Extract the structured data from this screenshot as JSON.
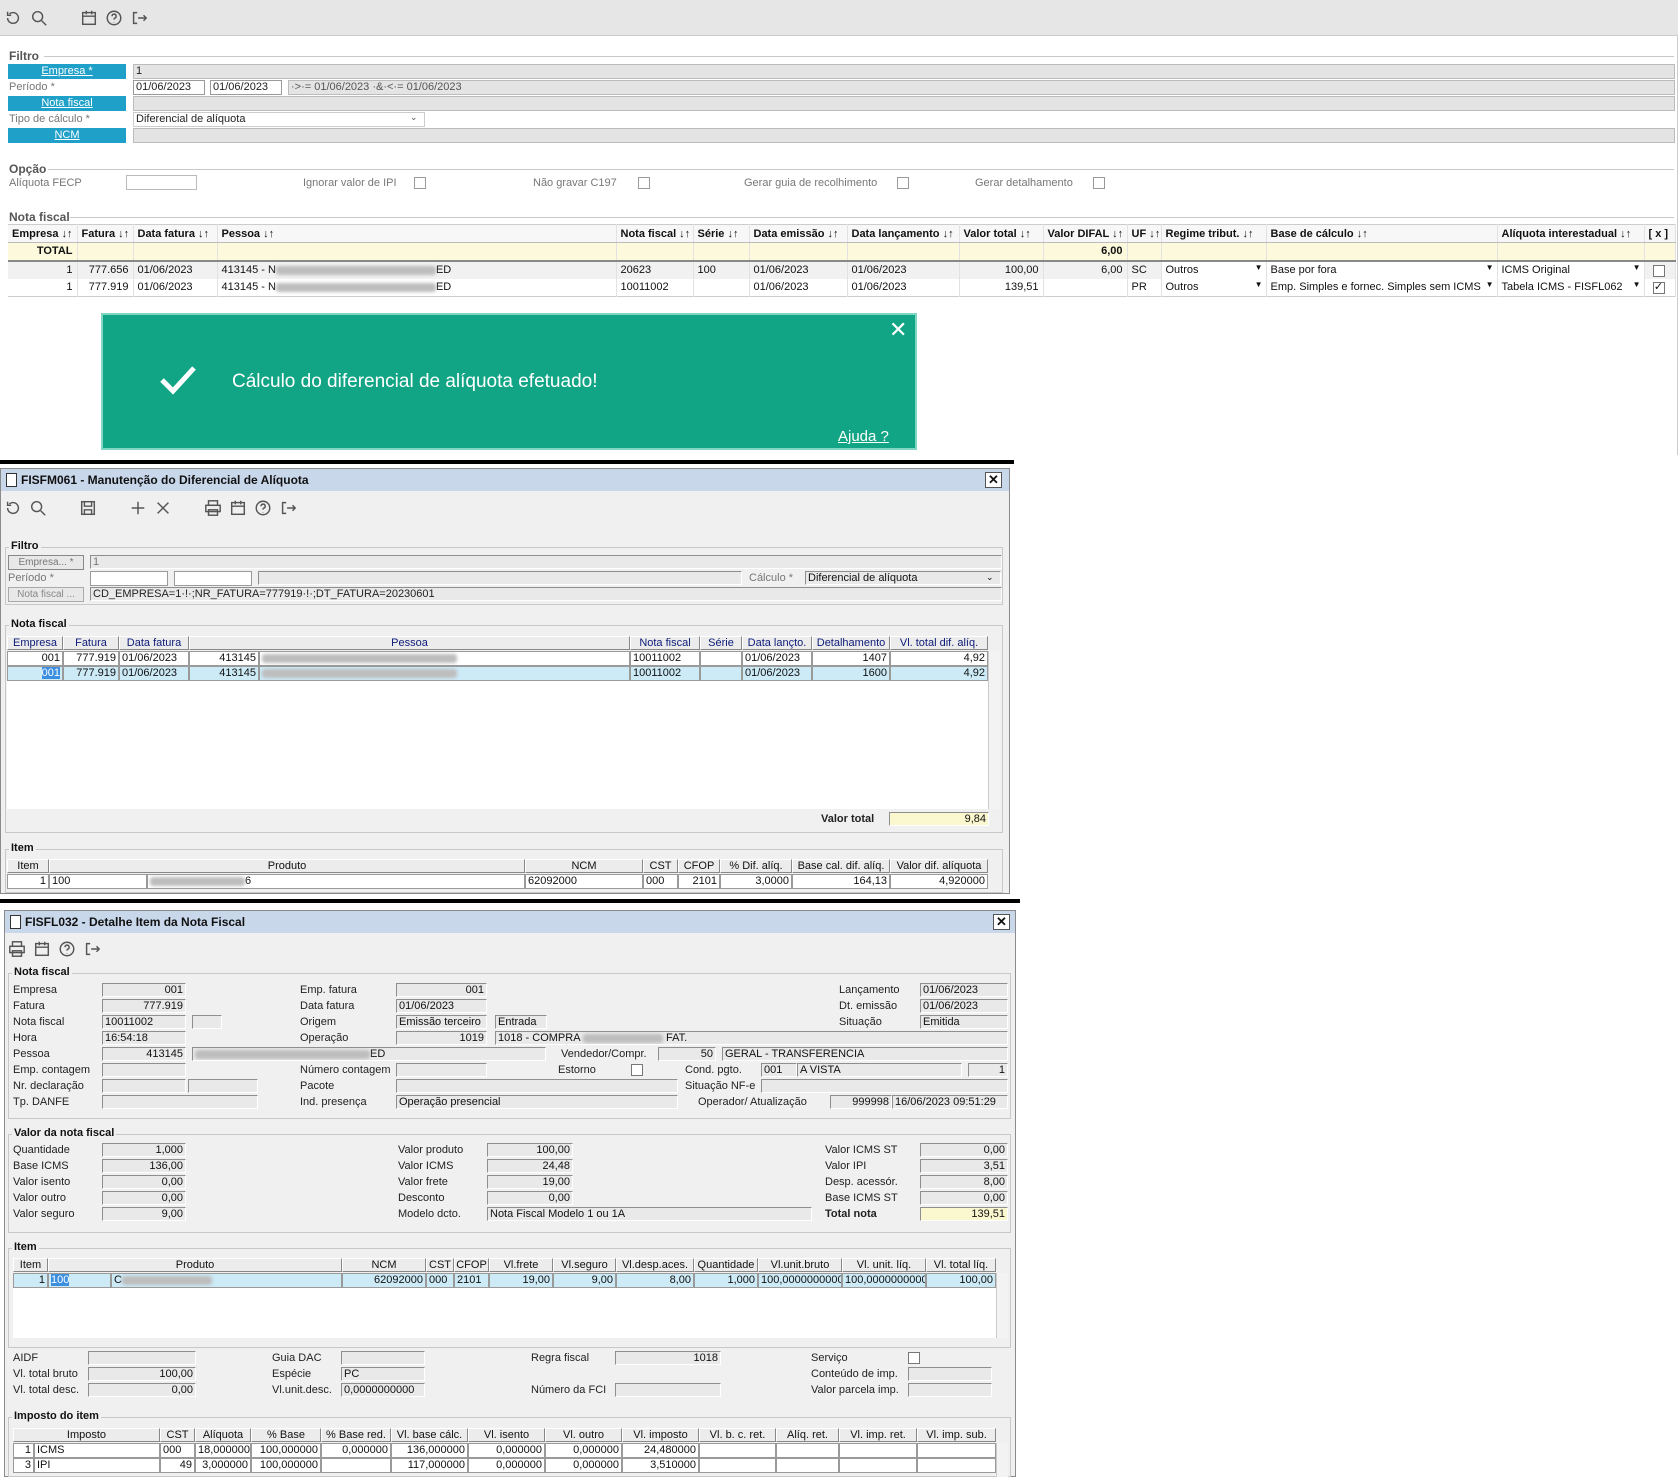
{
  "top": {
    "filtro": "Filtro",
    "empresa_label": "Empresa *",
    "empresa_value": "1",
    "periodo_label": "Período *",
    "periodo_from": "01/06/2023",
    "periodo_to": "01/06/2023",
    "periodo_expr": "·>·= 01/06/2023 ·&·<·= 01/06/2023",
    "nota_label": "Nota fiscal",
    "tipo_label": "Tipo de cálculo *",
    "tipo_value": "Diferencial de alíquota",
    "ncm_label": "NCM",
    "opcao": "Opção",
    "aliq_fecp": "Alíquota FECP",
    "ign_ipi": "Ignorar valor de IPI",
    "nao_gravar": "Não gravar C197",
    "gerar_guia": "Gerar guia de recolhimento",
    "gerar_det": "Gerar detalhamento",
    "nota_sect": "Nota fiscal",
    "cols": [
      "Empresa ↓↑",
      "Fatura ↓↑",
      "Data fatura ↓↑",
      "Pessoa ↓↑",
      "Nota fiscal ↓↑",
      "Série ↓↑",
      "Data emissão ↓↑",
      "Data lançamento ↓↑",
      "Valor total ↓↑",
      "Valor DIFAL ↓↑",
      "UF ↓↑",
      "Regime tribut. ↓↑",
      "Base de cálculo ↓↑",
      "Alíquota interestadual ↓↑",
      "[ x ]"
    ],
    "total_label": "TOTAL",
    "total_difal": "6,00",
    "rows": [
      {
        "empresa": "1",
        "fatura": "777.656",
        "data": "01/06/2023",
        "pessoa": "413145 - N",
        "pessoa_end": "ED",
        "nota": "20623",
        "serie": "100",
        "emissao": "01/06/2023",
        "lanc": "01/06/2023",
        "valor": "100,00",
        "difal": "6,00",
        "uf": "SC",
        "regime": "Outros",
        "base": "Base por fora",
        "aliq": "ICMS Original"
      },
      {
        "empresa": "1",
        "fatura": "777.919",
        "data": "01/06/2023",
        "pessoa": "413145 - N",
        "pessoa_end": "ED",
        "nota": "10011002",
        "serie": "",
        "emissao": "01/06/2023",
        "lanc": "01/06/2023",
        "valor": "139,51",
        "difal": "",
        "uf": "PR",
        "regime": "Outros",
        "base": "Emp. Simples e fornec. Simples sem ICMS",
        "aliq": "Tabela ICMS - FISFL062"
      }
    ],
    "toast": "Cálculo do diferencial de alíquota efetuado!",
    "ajuda": "Ajuda ?"
  },
  "win1": {
    "title": "FISFM061 - Manutenção do Diferencial de Alíquota",
    "filtro": "Filtro",
    "empresa": "Empresa... *",
    "empresa_value": "1",
    "periodo": "Período *",
    "calculo_label": "Cálculo *",
    "calculo_value": "Diferencial de alíquota",
    "nota_btn": "Nota fiscal ...",
    "nota_expr": "CD_EMPRESA=1·!·;NR_FATURA=777919·!·;DT_FATURA=20230601",
    "nota_sect": "Nota fiscal",
    "cols": [
      "Empresa",
      "Fatura",
      "Data fatura",
      "Pessoa",
      "Nota fiscal",
      "Série",
      "Data lançto.",
      "Detalhamento",
      "Vl. total dif. alíq."
    ],
    "rows": [
      {
        "empresa": "001",
        "fatura": "777.919",
        "data": "01/06/2023",
        "pessoa": "413145",
        "nota": "10011002",
        "serie": "",
        "lanc": "01/06/2023",
        "det": "1407",
        "vl": "4,92"
      },
      {
        "empresa": "001",
        "fatura": "777.919",
        "data": "01/06/2023",
        "pessoa": "413145",
        "nota": "10011002",
        "serie": "",
        "lanc": "01/06/2023",
        "det": "1600",
        "vl": "4,92"
      }
    ],
    "valor_total_label": "Valor total",
    "valor_total": "9,84",
    "item_sect": "Item",
    "icols": [
      "Item",
      "Produto",
      "NCM",
      "CST",
      "CFOP",
      "% Dif. alíq.",
      "Base cal. dif. alíq.",
      "Valor dif. alíquota"
    ],
    "irow": {
      "item": "1",
      "prod": "100",
      "prod_end": "6",
      "ncm": "62092000",
      "cst": "000",
      "cfop": "2101",
      "pct": "3,0000",
      "base": "164,13",
      "valor": "4,920000"
    }
  },
  "win2": {
    "title": "FISFL032 - Detalhe Item da Nota Fiscal",
    "nf_sect": "Nota fiscal",
    "empresa_l": "Empresa",
    "empresa": "001",
    "fatura_l": "Fatura",
    "fatura": "777.919",
    "nota_l": "Nota fiscal",
    "nota": "10011002",
    "hora_l": "Hora",
    "hora": "16:54:18",
    "pessoa_l": "Pessoa",
    "pessoa": "413145",
    "pessoa_end": "ED",
    "empc_l": "Emp. contagem",
    "nrdecl_l": "Nr. declaração",
    "tpdanfe_l": "Tp. DANFE",
    "empfat_l": "Emp. fatura",
    "empfat": "001",
    "datafat_l": "Data fatura",
    "datafat": "01/06/2023",
    "origem_l": "Origem",
    "origem": "Emissão terceiro",
    "origem2": "Entrada",
    "oper_l": "Operação",
    "oper": "1019",
    "oper_desc": "1018 - COMPRA",
    "oper_desc_end": "FAT.",
    "vend_l": "Vendedor/Compr.",
    "vend": "50",
    "vend_desc": "GERAL - TRANSFERENCIA",
    "numc_l": "Número contagem",
    "estorno_l": "Estorno",
    "cond_l": "Cond. pgto.",
    "cond": "001",
    "cond_desc": "A VISTA",
    "cond_n": "1",
    "pacote_l": "Pacote",
    "sit_nfe_l": "Situação NF-e",
    "indpres_l": "Ind. presença",
    "indpres": "Operação presencial",
    "operador_l": "Operador/ Atualização",
    "operador": "999998",
    "atual": "16/06/2023 09:51:29",
    "lanc_l": "Lançamento",
    "lanc": "01/06/2023",
    "dtem_l": "Dt. emissão",
    "dtem": "01/06/2023",
    "sit_l": "Situação",
    "sit": "Emitida",
    "valor_sect": "Valor da nota fiscal",
    "qtd_l": "Quantidade",
    "qtd": "1,000",
    "bicms_l": "Base ICMS",
    "bicms": "136,00",
    "visento_l": "Valor isento",
    "visento": "0,00",
    "voutro_l": "Valor outro",
    "voutro": "0,00",
    "vseg_l": "Valor seguro",
    "vseg": "9,00",
    "vprod_l": "Valor produto",
    "vprod": "100,00",
    "vicms_l": "Valor ICMS",
    "vicms": "24,48",
    "vfrete_l": "Valor frete",
    "vfrete": "19,00",
    "desc_l": "Desconto",
    "desc": "0,00",
    "modelo_l": "Modelo dcto.",
    "modelo": "Nota Fiscal Modelo 1 ou 1A",
    "vicmsst_l": "Valor ICMS ST",
    "vicmsst": "0,00",
    "vipi_l": "Valor IPI",
    "vipi": "3,51",
    "desp_l": "Desp. acessór.",
    "desp": "8,00",
    "bicmsst_l": "Base ICMS ST",
    "bicmsst": "0,00",
    "total_l": "Total nota",
    "total": "139,51",
    "item_sect": "Item",
    "icols": [
      "Item",
      "Produto",
      "NCM",
      "CST",
      "CFOP",
      "Vl.frete",
      "Vl.seguro",
      "Vl.desp.aces.",
      "Quantidade",
      "Vl.unit.bruto",
      "Vl. unit. líq.",
      "Vl. total líq."
    ],
    "irow": {
      "item": "1",
      "prod": "100",
      "prod2": "C",
      "ncm": "62092000",
      "cst": "000",
      "cfop": "2101",
      "frete": "19,00",
      "seguro": "9,00",
      "desp": "8,00",
      "qtd": "1,000",
      "ub": "100,0000000000",
      "ul": "100,0000000000",
      "tl": "100,00"
    },
    "aidf_l": "AIDF",
    "vtb_l": "Vl. total bruto",
    "vtb": "100,00",
    "vtd_l": "Vl. total desc.",
    "vtd": "0,00",
    "guia_l": "Guia DAC",
    "esp_l": "Espécie",
    "esp": "PC",
    "vud_l": "Vl.unit.desc.",
    "vud": "0,0000000000",
    "regra_l": "Regra fiscal",
    "regra": "1018",
    "fci_l": "Número da FCI",
    "serv_l": "Serviço",
    "cont_l": "Conteúdo de imp.",
    "vpi_l": "Valor parcela imp.",
    "imp_sect": "Imposto do item",
    "tcols": [
      "Imposto",
      "CST",
      "Alíquota",
      "% Base",
      "% Base red.",
      "Vl. base cálc.",
      "Vl. isento",
      "Vl. outro",
      "Vl. imposto",
      "Vl. b. c. ret.",
      "Alíq. ret.",
      "Vl. imp. ret.",
      "Vl. imp. sub."
    ],
    "trows": [
      {
        "n": "1",
        "imp": "ICMS",
        "cst": "000",
        "aliq": "18,000000",
        "pb": "100,000000",
        "pbr": "0,000000",
        "vbc": "136,000000",
        "vi": "0,000000",
        "vo": "0,000000",
        "vimp": "24,480000"
      },
      {
        "n": "3",
        "imp": "IPI",
        "cst": "49",
        "aliq": "3,000000",
        "pb": "100,000000",
        "pbr": "",
        "vbc": "117,000000",
        "vi": "0,000000",
        "vo": "0,000000",
        "vimp": "3,510000"
      }
    ]
  }
}
